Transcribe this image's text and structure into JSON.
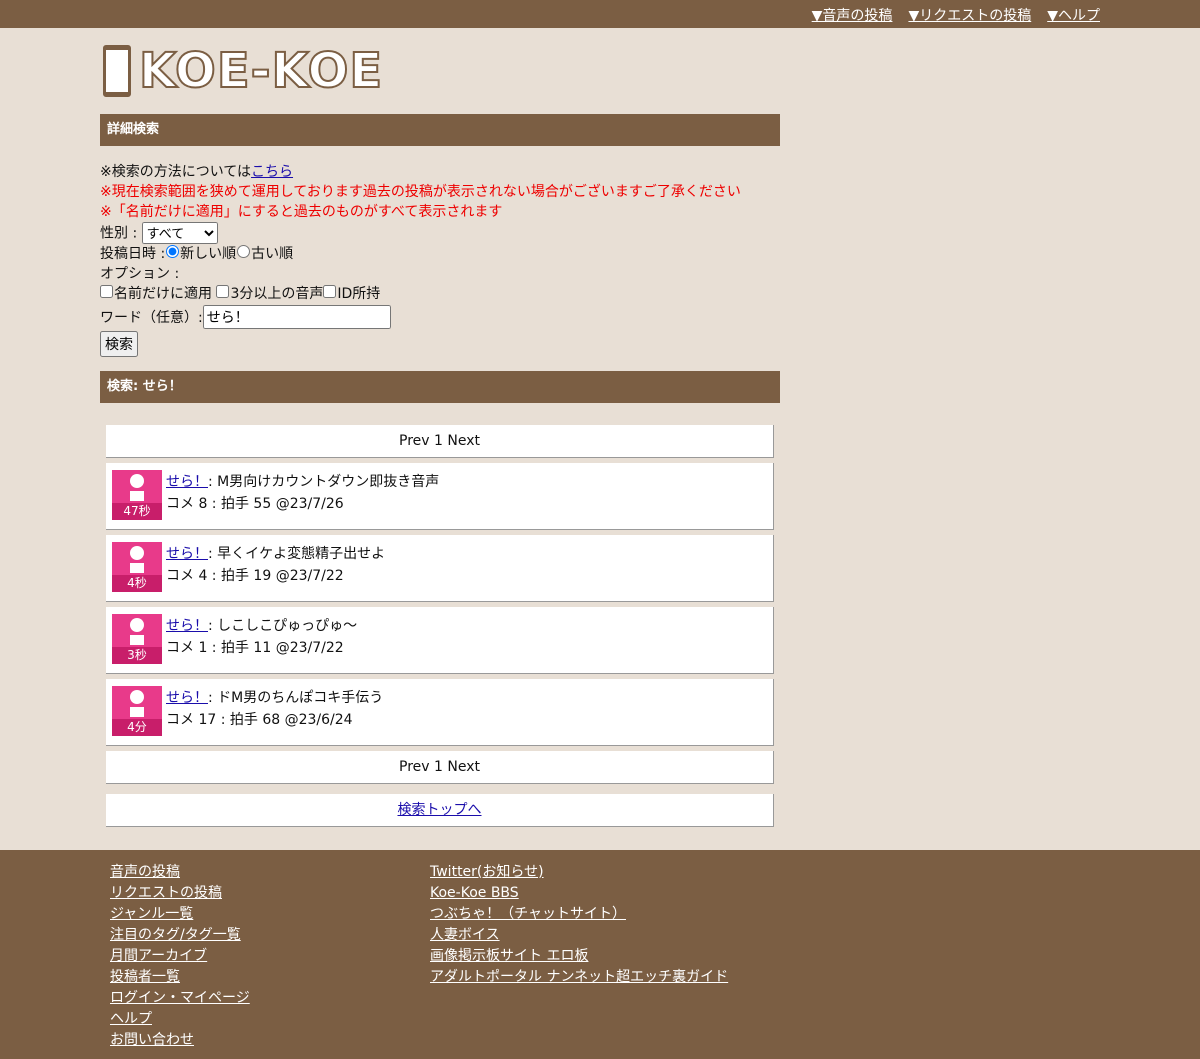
{
  "topnav": [
    "▼音声の投稿",
    "▼リクエストの投稿",
    "▼ヘルプ"
  ],
  "logo_text": "KOE-KOE",
  "search_section": {
    "title": "詳細検索"
  },
  "form": {
    "note_prefix": "※検索の方法については",
    "note_link": "こちら",
    "warning1": "※現在検索範囲を狭めて運用しております過去の投稿が表示されない場合がございますご了承ください",
    "warning2": "※「名前だけに適用」にすると過去のものがすべて表示されます",
    "gender_label": "性別 :",
    "gender_selected": "すべて",
    "date_label": "投稿日時 :",
    "date_new": "新しい順",
    "date_old": "古い順",
    "options_label": "オプション :",
    "opt_name_only": "名前だけに適用",
    "opt_3min": "3分以上の音声",
    "opt_id": "ID所持",
    "word_label": "ワード（任意）:",
    "word_value": "せら！",
    "search_button": "検索"
  },
  "results_section": {
    "title": "検索: せら！"
  },
  "pager": {
    "prev": "Prev",
    "page": "1",
    "next": "Next"
  },
  "results": [
    {
      "author": "せら！",
      "title": ": M男向けカウントダウン即抜き音声",
      "meta": "コメ 8 : 拍手 55 @23/7/26",
      "duration": "47秒"
    },
    {
      "author": "せら！",
      "title": ": 早くイケよ変態精子出せよ",
      "meta": "コメ 4 : 拍手 19 @23/7/22",
      "duration": "4秒"
    },
    {
      "author": "せら！",
      "title": ": しこしこぴゅっぴゅ〜",
      "meta": "コメ 1 : 拍手 11 @23/7/22",
      "duration": "3秒"
    },
    {
      "author": "せら！",
      "title": ": ドM男のちんぽコキ手伝う",
      "meta": "コメ 17 : 拍手 68 @23/6/24",
      "duration": "4分"
    }
  ],
  "back_link": "検索トップへ",
  "footer": {
    "left": [
      "音声の投稿",
      "リクエストの投稿",
      "ジャンル一覧",
      "注目のタグ/タグ一覧",
      "月間アーカイブ",
      "投稿者一覧",
      "ログイン・マイページ",
      "ヘルプ",
      "お問い合わせ"
    ],
    "right": [
      "Twitter(お知らせ)",
      "Koe-Koe BBS",
      "つぶちゃ！（チャットサイト）",
      "人妻ボイス",
      "画像掲示板サイト エロ板",
      "アダルトポータル ナンネット超エッチ裏ガイド"
    ]
  },
  "colors": {
    "brand_brown": "#7b5e43",
    "background": "#e8dfd5",
    "thumb_pink": "#e83a8a",
    "warning_red": "#e00000"
  }
}
